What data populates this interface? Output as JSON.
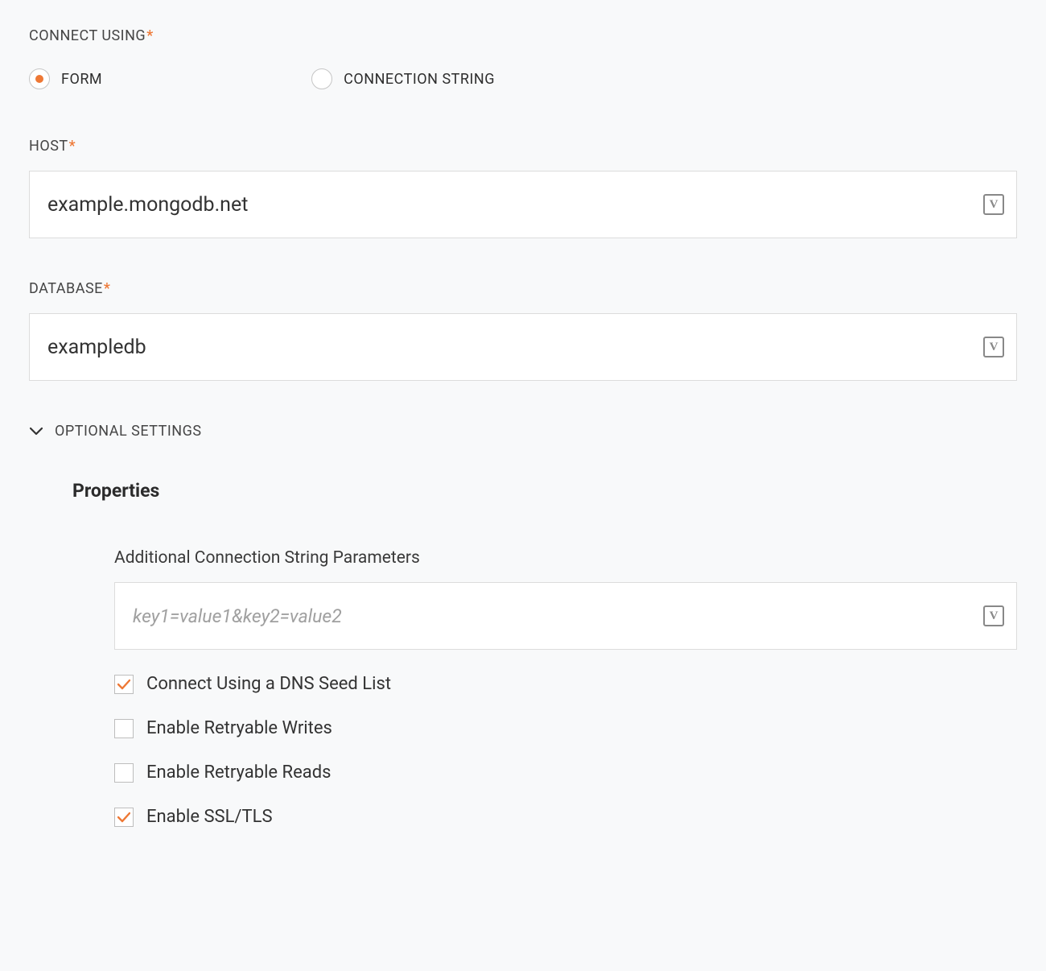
{
  "connect_using": {
    "label": "CONNECT USING",
    "required_marker": "*",
    "options": {
      "form": "FORM",
      "connection_string": "CONNECTION STRING"
    },
    "selected": "form"
  },
  "host": {
    "label": "HOST",
    "required_marker": "*",
    "value": "example.mongodb.net",
    "badge": "V"
  },
  "database": {
    "label": "DATABASE",
    "required_marker": "*",
    "value": "exampledb",
    "badge": "V"
  },
  "optional_settings": {
    "label": "OPTIONAL SETTINGS",
    "expanded": true
  },
  "properties": {
    "heading": "Properties",
    "additional_params": {
      "label": "Additional Connection String Parameters",
      "value": "",
      "placeholder": "key1=value1&key2=value2",
      "badge": "V"
    },
    "checkboxes": {
      "dns_seed": {
        "label": "Connect Using a DNS Seed List",
        "checked": true
      },
      "retry_writes": {
        "label": "Enable Retryable Writes",
        "checked": false
      },
      "retry_reads": {
        "label": "Enable Retryable Reads",
        "checked": false
      },
      "ssl_tls": {
        "label": "Enable SSL/TLS",
        "checked": true
      }
    }
  }
}
